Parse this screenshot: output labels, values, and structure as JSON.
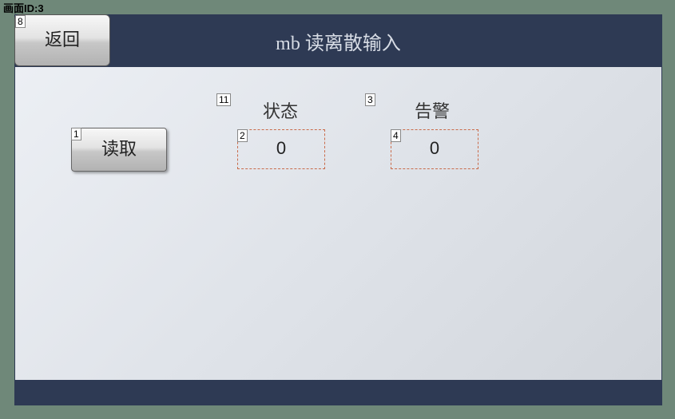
{
  "page_id_label": "画面ID:3",
  "header": {
    "back_label": "返回",
    "title": "mb 读离散输入"
  },
  "tags": {
    "back": "8",
    "status_label": "11",
    "status_box": "2",
    "alarm_label": "3",
    "alarm_box": "4",
    "read_btn": "1"
  },
  "content": {
    "status_label": "状态",
    "alarm_label": "告警",
    "read_label": "读取",
    "status_value": "0",
    "alarm_value": "0"
  }
}
